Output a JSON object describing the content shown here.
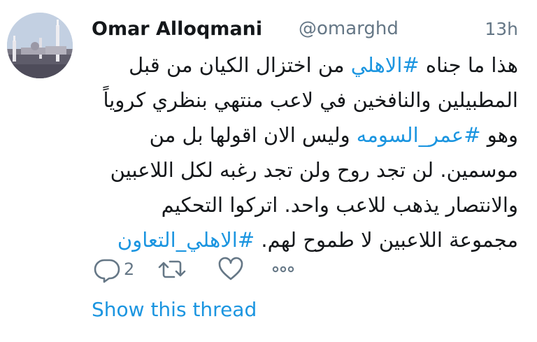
{
  "tweet": {
    "author_name": "Omar Alloqmani",
    "author_handle": "@omarghd",
    "time": "13h",
    "body_segments": [
      {
        "type": "text",
        "text": "هذا ما جناه "
      },
      {
        "type": "hashtag",
        "text": "#الاهلي"
      },
      {
        "type": "text",
        "text": " من اختزال الكيان من قبل المطبيلين والنافخين في لاعب منتهي بنظري كروياً وهو "
      },
      {
        "type": "hashtag",
        "text": "#عمر_السومه"
      },
      {
        "type": "text",
        "text": " وليس الان اقولها بل من موسمين. لن تجد روح ولن تجد رغبه لكل اللاعبين والانتصار يذهب للاعب واحد. اتركوا التحكيم مجموعة اللاعبين لا طموح لهم. "
      },
      {
        "type": "hashtag",
        "text": "#الاهلي_التعاون"
      }
    ],
    "actions": {
      "reply_icon": "reply-icon",
      "reply_count": "2",
      "retweet_icon": "retweet-icon",
      "like_icon": "heart-icon",
      "more_icon": "more-icon"
    },
    "show_thread_label": "Show this thread"
  },
  "colors": {
    "text": "#14171a",
    "secondary": "#657786",
    "link": "#1b95e0"
  }
}
